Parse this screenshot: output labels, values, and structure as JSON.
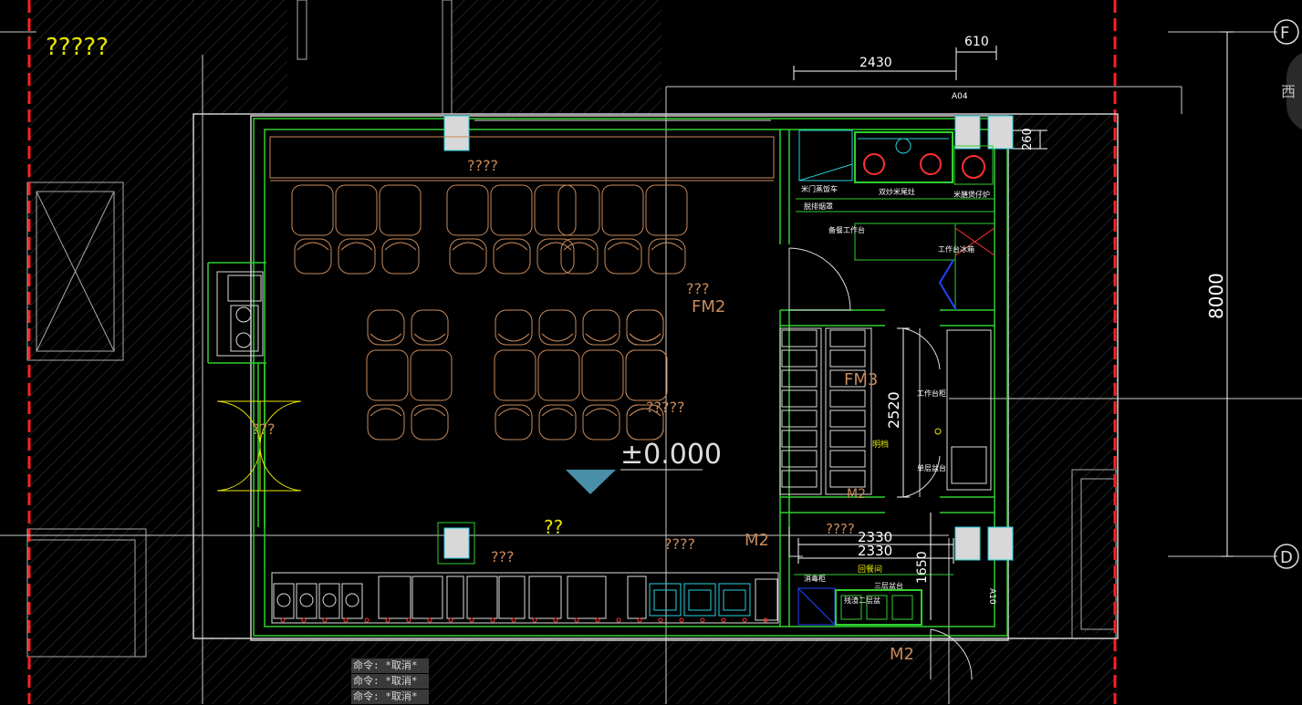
{
  "drawing": {
    "title_text": "?????",
    "grid_labels": {
      "top": "F",
      "bottom": "D"
    },
    "dimensions": {
      "d2430": "2430",
      "d610": "610",
      "d260": "260",
      "d8000": "8000",
      "d2520": "2520",
      "d2330a": "2330",
      "d2330b": "2330",
      "d1650": "1650"
    },
    "tags": {
      "a04": "A04",
      "a10": "A10"
    },
    "room_labels": {
      "top_counter": "????",
      "fm2_q": "???",
      "fm2": "FM2",
      "fm3": "FM3",
      "mid_q": "?????",
      "elevation": "±0.000",
      "door_q": "???",
      "center_q": "??",
      "bottom_q": "???",
      "right_q": "????",
      "m2_inner": "M2",
      "m2_small": "M2",
      "m2_bottom": "M2",
      "right_q2": "????"
    },
    "equipment_labels": {
      "steamer": "米门蒸饭车",
      "wok_stove": "双炒米尾灶",
      "griddle": "米膳煲仔炉",
      "hood": "脱排烟罩",
      "prep_table": "备餐工作台",
      "fridge": "工作台冰箱",
      "work_cabinet": "工作台柜",
      "triple_sink_right": "单层盆台",
      "shelf": "明档",
      "dish_return": "回餐间",
      "sterilizer": "消毒柜",
      "triple_sink": "三层盆台",
      "dish_sink": "残渣二层盆"
    }
  },
  "colors": {
    "wall": "#2fd02f",
    "outline": "#e8e8e8",
    "furniture": "#c98a5a",
    "dimension": "#ffffff",
    "grid_axis": "#e8e8e8",
    "gridline_red": "#ff2020",
    "hatch": "#4a4a4a",
    "cyan": "#27d0e0",
    "yellow": "#e6e600",
    "blue": "#2244ff",
    "red": "#ff3030",
    "marker": "#4a8fa8"
  },
  "command_line": [
    "命令: *取消*",
    "命令: *取消*",
    "命令: *取消*"
  ],
  "compass_label": "西"
}
